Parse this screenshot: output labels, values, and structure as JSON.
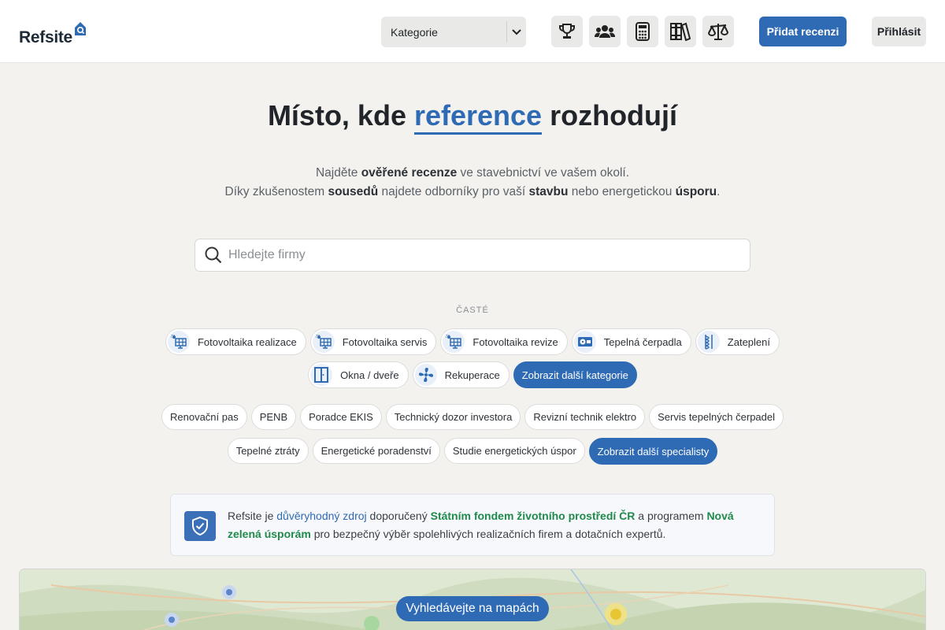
{
  "header": {
    "logo_text": "Refsite",
    "category_select": {
      "value": "Kategorie"
    },
    "icon_buttons": [
      {
        "name": "trophy-icon"
      },
      {
        "name": "users-icon"
      },
      {
        "name": "calculator-icon"
      },
      {
        "name": "books-icon"
      },
      {
        "name": "scale-icon"
      }
    ],
    "add_review_label": "Přidat recenzi",
    "login_label": "Přihlásit"
  },
  "hero": {
    "title_before": "Místo, kde ",
    "title_highlight": "reference",
    "title_after": " rozhodují",
    "line1": {
      "a": "Najděte ",
      "b": "ověřené recenze",
      "c": " ve stavebnictví ve vašem okolí."
    },
    "line2": {
      "a": "Díky zkušenostem ",
      "b": "sousedů",
      "c": " najdete odborníky pro vaší ",
      "d": "stavbu",
      "e": " nebo energetickou ",
      "f": "úsporu",
      "g": "."
    }
  },
  "search": {
    "placeholder": "Hledejte firmy",
    "value": ""
  },
  "frequent": {
    "label": "ČASTÉ",
    "categories": [
      {
        "label": "Fotovoltaika realizace",
        "icon": "solar-panel-icon"
      },
      {
        "label": "Fotovoltaika servis",
        "icon": "solar-panel-icon"
      },
      {
        "label": "Fotovoltaika revize",
        "icon": "solar-panel-icon"
      },
      {
        "label": "Tepelná čerpadla",
        "icon": "heat-pump-icon"
      },
      {
        "label": "Zateplení",
        "icon": "insulation-icon"
      },
      {
        "label": "Okna / dveře",
        "icon": "window-icon"
      },
      {
        "label": "Rekuperace",
        "icon": "fan-icon"
      }
    ],
    "more_categories_label": "Zobrazit další kategorie",
    "specialists": [
      "Renovační pas",
      "PENB",
      "Poradce EKIS",
      "Technický dozor investora",
      "Revizní technik elektro",
      "Servis tepelných čerpadel",
      "Tepelné ztráty",
      "Energetické poradenství",
      "Studie energetických úspor"
    ],
    "more_specialists_label": "Zobrazit další specialisty"
  },
  "trust": {
    "t1": "Refsite je ",
    "t2": "důvěryhodný zdroj",
    "t3": " doporučený ",
    "t4": "Státním fondem životního prostředí ČR",
    "t5": " a programem ",
    "t6": "Nová zelená úsporám",
    "t7": " pro bezpečný výběr spolehlivých realizačních firem a dotačních expertů."
  },
  "map": {
    "button_label": "Vyhledávejte na mapách"
  },
  "colors": {
    "primary": "#2f6ab4",
    "green": "#1f8a4c",
    "background": "#f3f2ee"
  }
}
